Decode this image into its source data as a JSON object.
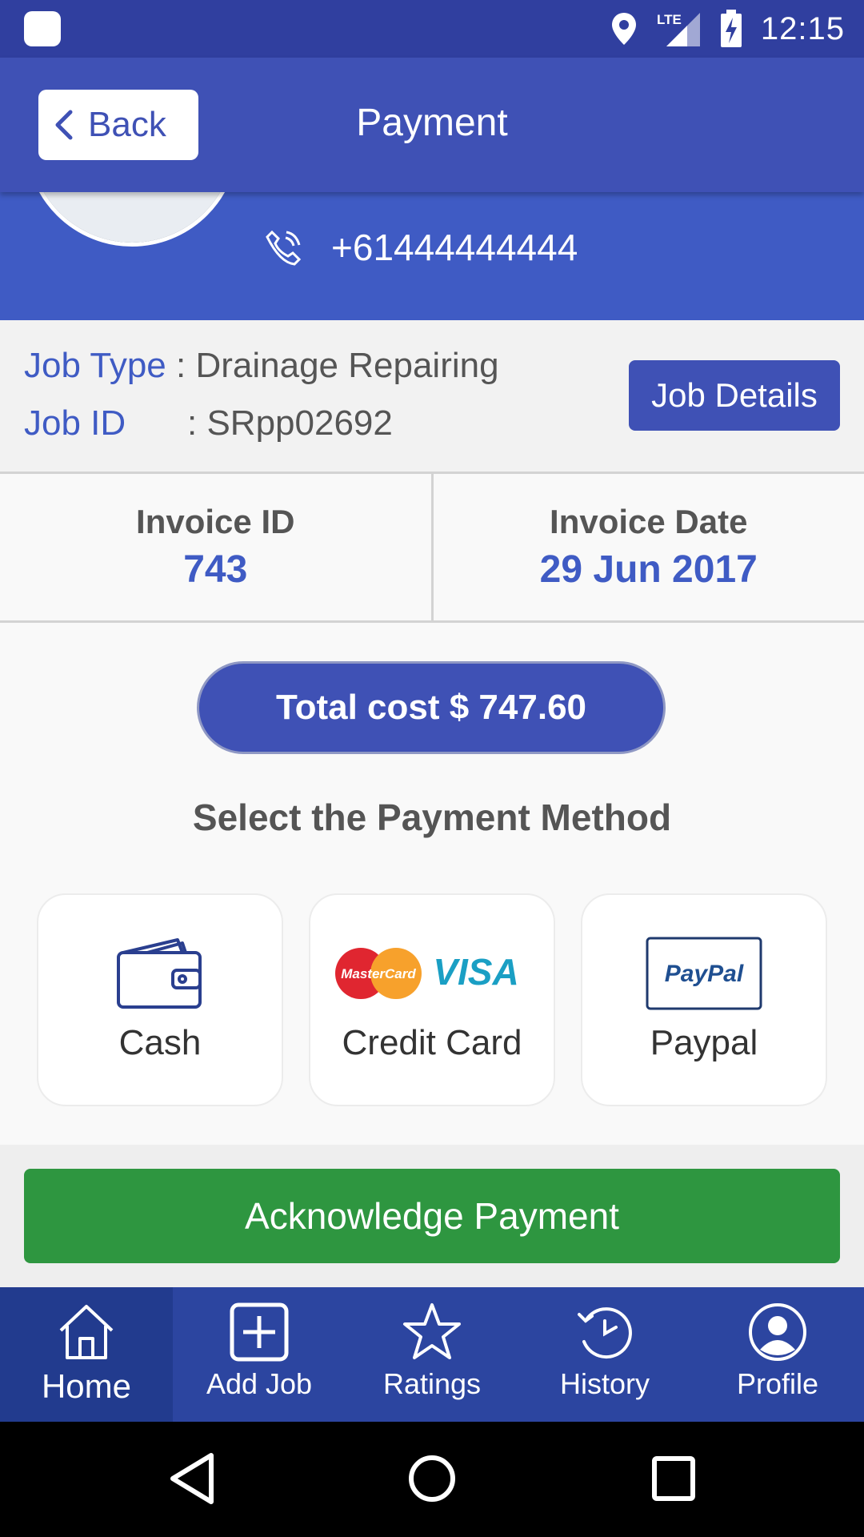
{
  "status_bar": {
    "time": "12:15",
    "network": "LTE"
  },
  "header": {
    "back_label": "Back",
    "title": "Payment"
  },
  "profile": {
    "phone": "+61444444444"
  },
  "job": {
    "type_label": "Job Type",
    "type_value": ": Drainage Repairing",
    "id_label": "Job ID",
    "id_value": ": SRpp02692",
    "details_button": "Job Details"
  },
  "invoice": {
    "id_label": "Invoice ID",
    "id_value": "743",
    "date_label": "Invoice Date",
    "date_value": "29 Jun 2017"
  },
  "payment": {
    "total": "Total cost $ 747.60",
    "heading": "Select the Payment Method",
    "methods": [
      {
        "label": "Cash",
        "icon": "wallet-icon"
      },
      {
        "label": "Credit Card",
        "icon": "mastercard-visa-logo",
        "logo_text_1": "MasterCard",
        "logo_text_2": "VISA"
      },
      {
        "label": "Paypal",
        "icon": "paypal-logo",
        "logo_text": "PayPal"
      }
    ],
    "acknowledge_button": "Acknowledge Payment"
  },
  "bottom_nav": {
    "items": [
      {
        "label": "Home",
        "icon": "home-icon",
        "active": true
      },
      {
        "label": "Add Job",
        "icon": "add-job-icon"
      },
      {
        "label": "Ratings",
        "icon": "star-icon"
      },
      {
        "label": "History",
        "icon": "history-icon"
      },
      {
        "label": "Profile",
        "icon": "profile-icon"
      }
    ]
  },
  "colors": {
    "primary": "#3f51b5",
    "status_bar": "#303f9f",
    "accent_blue": "#3f5bc4",
    "success": "#2e9640",
    "nav": "#2c45a0"
  }
}
